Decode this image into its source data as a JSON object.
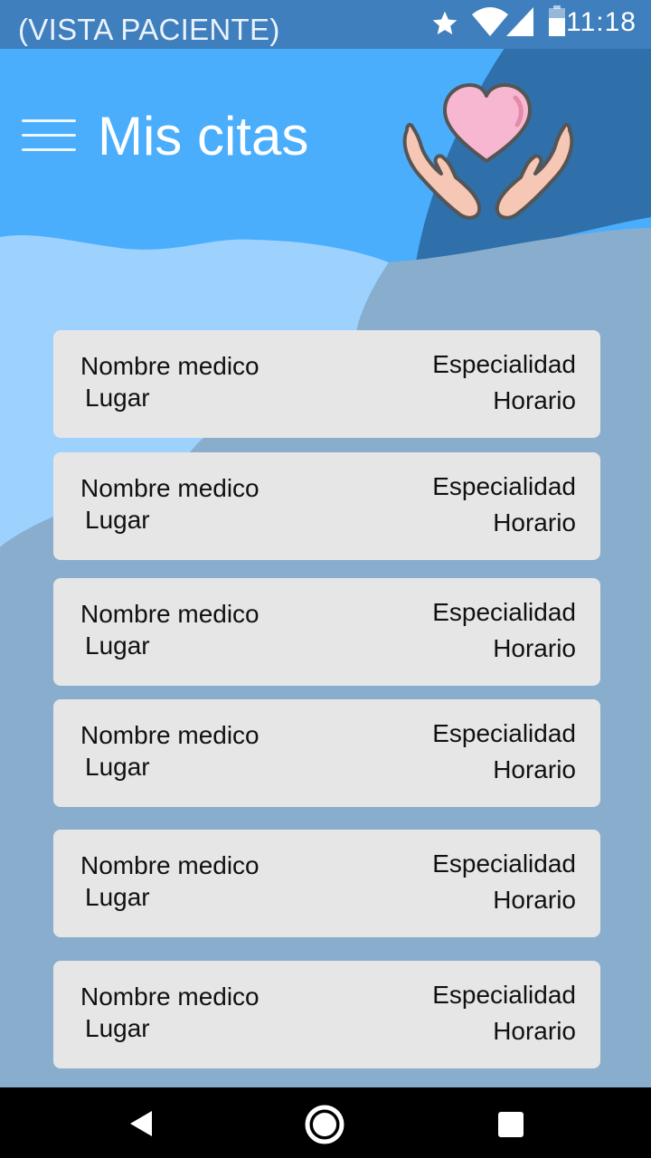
{
  "status_bar": {
    "label": "(VISTA PACIENTE)",
    "time": "11:18",
    "icons": [
      "star-icon",
      "wifi-icon",
      "cell-signal-icon",
      "battery-icon"
    ]
  },
  "header": {
    "title": "Mis citas",
    "menu_icon": "hamburger-menu-icon",
    "logo_icon": "heart-in-hands-icon"
  },
  "appointments": [
    {
      "doctor": "Nombre medico",
      "place": "Lugar",
      "specialty": "Especialidad",
      "schedule": "Horario"
    },
    {
      "doctor": "Nombre medico",
      "place": "Lugar",
      "specialty": "Especialidad",
      "schedule": "Horario"
    },
    {
      "doctor": "Nombre medico",
      "place": "Lugar",
      "specialty": "Especialidad",
      "schedule": "Horario"
    },
    {
      "doctor": "Nombre medico",
      "place": "Lugar",
      "specialty": "Especialidad",
      "schedule": "Horario"
    },
    {
      "doctor": "Nombre medico",
      "place": "Lugar",
      "specialty": "Especialidad",
      "schedule": "Horario"
    },
    {
      "doctor": "Nombre medico",
      "place": "Lugar",
      "specialty": "Especialidad",
      "schedule": "Horario"
    }
  ],
  "nav_bar": {
    "icons": [
      "back-icon",
      "home-icon",
      "recents-icon"
    ]
  },
  "colors": {
    "header_blue": "#4aaefc",
    "dark_blue": "#2f6faa",
    "light_blue": "#9cd2fd",
    "muted_blue": "#89aecd",
    "card_bg": "#e6e6e6",
    "status_bar": "#3f7fbd"
  }
}
